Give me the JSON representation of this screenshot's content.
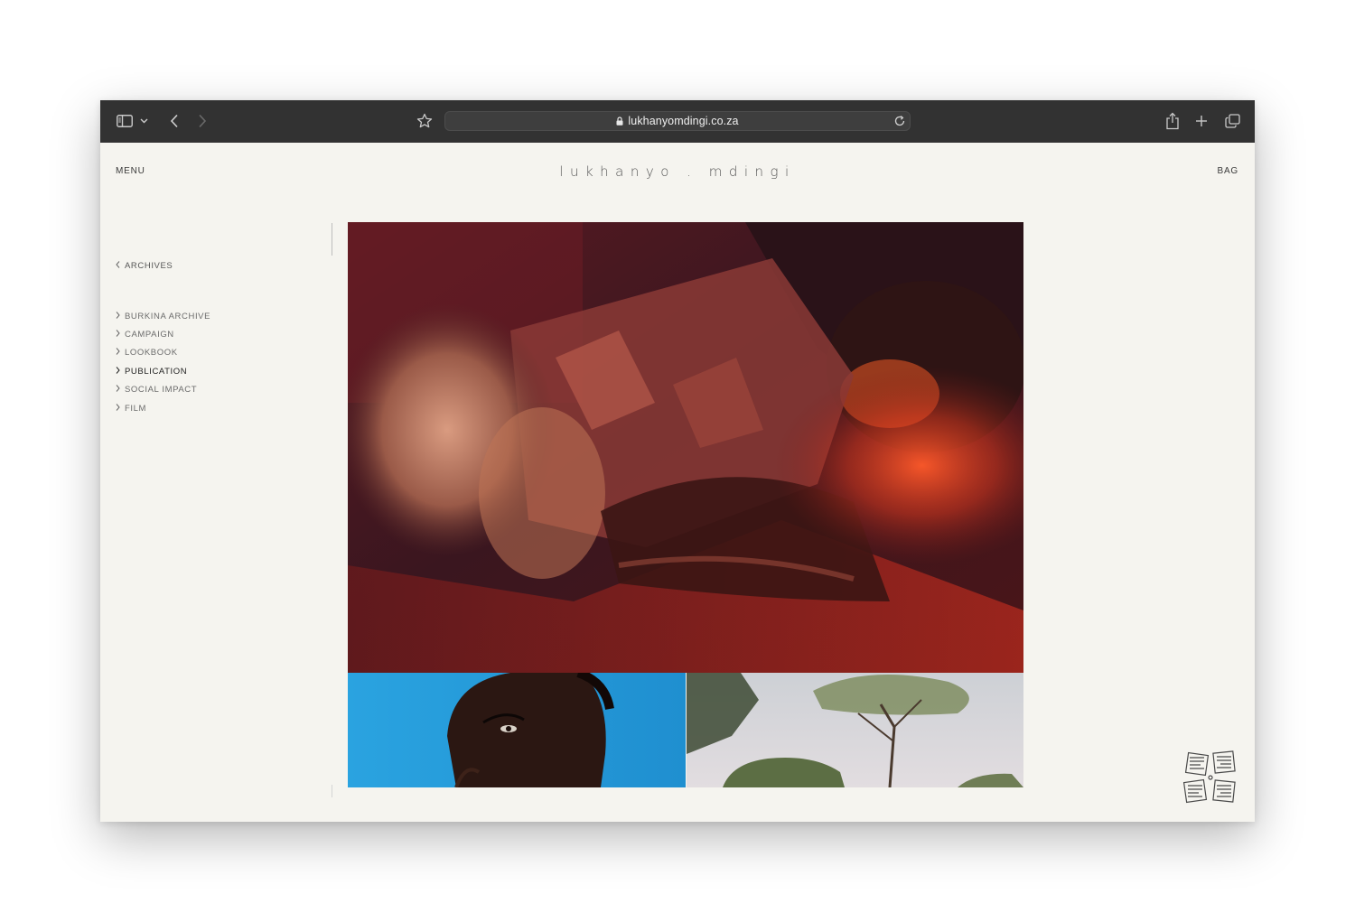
{
  "browser": {
    "url": "lukhanyomdingi.co.za",
    "icons": [
      "sidebar-icon",
      "chevron-down-icon",
      "back-icon",
      "forward-icon",
      "star-icon",
      "lock-icon",
      "reload-icon",
      "share-icon",
      "plus-icon",
      "tabs-icon"
    ]
  },
  "header": {
    "menu_label": "MENU",
    "brand": "lukhanyo . mdingi",
    "bag_label": "BAG"
  },
  "sidebar": {
    "back_label": "ARCHIVES",
    "items": [
      {
        "label": "BURKINA ARCHIVE"
      },
      {
        "label": "CAMPAIGN"
      },
      {
        "label": "LOOKBOOK"
      },
      {
        "label": "PUBLICATION"
      },
      {
        "label": "SOCIAL IMPACT"
      },
      {
        "label": "FILM"
      }
    ],
    "active_item": "PUBLICATION"
  },
  "gallery": {
    "images": [
      "hero-portrait-red",
      "portrait-blue-background",
      "tree-landscape"
    ]
  },
  "colors": {
    "toolbar": "#323232",
    "page_background": "#f5f4ef",
    "text_active": "#1e1e1e",
    "text_muted": "#6b6b6b"
  }
}
